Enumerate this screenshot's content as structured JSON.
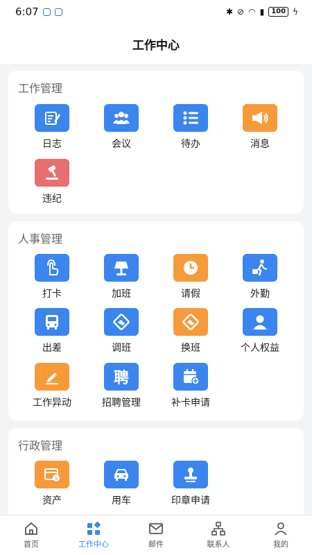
{
  "status_bar": {
    "time": "6:07",
    "battery": "100"
  },
  "header": {
    "title": "工作中心"
  },
  "sections": [
    {
      "title": "工作管理",
      "items": [
        {
          "label": "日志",
          "icon": "journal-icon",
          "color": "#3a85ee"
        },
        {
          "label": "会议",
          "icon": "people-icon",
          "color": "#3a85ee"
        },
        {
          "label": "待办",
          "icon": "list-icon",
          "color": "#3a85ee"
        },
        {
          "label": "消息",
          "icon": "megaphone-icon",
          "color": "#f79a3a"
        },
        {
          "label": "违纪",
          "icon": "gavel-icon",
          "color": "#e96e6e"
        }
      ]
    },
    {
      "title": "人事管理",
      "items": [
        {
          "label": "打卡",
          "icon": "tap-icon",
          "color": "#3a85ee"
        },
        {
          "label": "加班",
          "icon": "lamp-icon",
          "color": "#3a85ee"
        },
        {
          "label": "请假",
          "icon": "clock-icon",
          "color": "#f79a3a"
        },
        {
          "label": "外勤",
          "icon": "traveler-icon",
          "color": "#3a85ee"
        },
        {
          "label": "出差",
          "icon": "bus-icon",
          "color": "#3a85ee"
        },
        {
          "label": "调班",
          "icon": "handshake-icon",
          "color": "#3a85ee"
        },
        {
          "label": "换班",
          "icon": "handshake-icon",
          "color": "#f79a3a"
        },
        {
          "label": "个人权益",
          "icon": "person-icon",
          "color": "#3a85ee"
        },
        {
          "label": "工作异动",
          "icon": "pen-icon",
          "color": "#f79a3a"
        },
        {
          "label": "招聘管理",
          "icon": "recruit-icon",
          "color": "#3a85ee",
          "glyph": "聘"
        },
        {
          "label": "补卡申请",
          "icon": "calendar-add-icon",
          "color": "#3a85ee"
        }
      ]
    },
    {
      "title": "行政管理",
      "items": [
        {
          "label": "资产",
          "icon": "asset-icon",
          "color": "#f79a3a"
        },
        {
          "label": "用车",
          "icon": "car-icon",
          "color": "#3a85ee"
        },
        {
          "label": "印章申请",
          "icon": "stamp-icon",
          "color": "#3a85ee"
        }
      ]
    }
  ],
  "tabbar": [
    {
      "label": "首页",
      "icon": "home-icon",
      "active": false
    },
    {
      "label": "工作中心",
      "icon": "grid-icon",
      "active": true
    },
    {
      "label": "邮件",
      "icon": "mail-icon",
      "active": false
    },
    {
      "label": "联系人",
      "icon": "org-chart-icon",
      "active": false
    },
    {
      "label": "我的",
      "icon": "user-icon",
      "active": false
    }
  ],
  "colors": {
    "accent": "#3a85ee",
    "orange": "#f79a3a",
    "red": "#e96e6e"
  }
}
